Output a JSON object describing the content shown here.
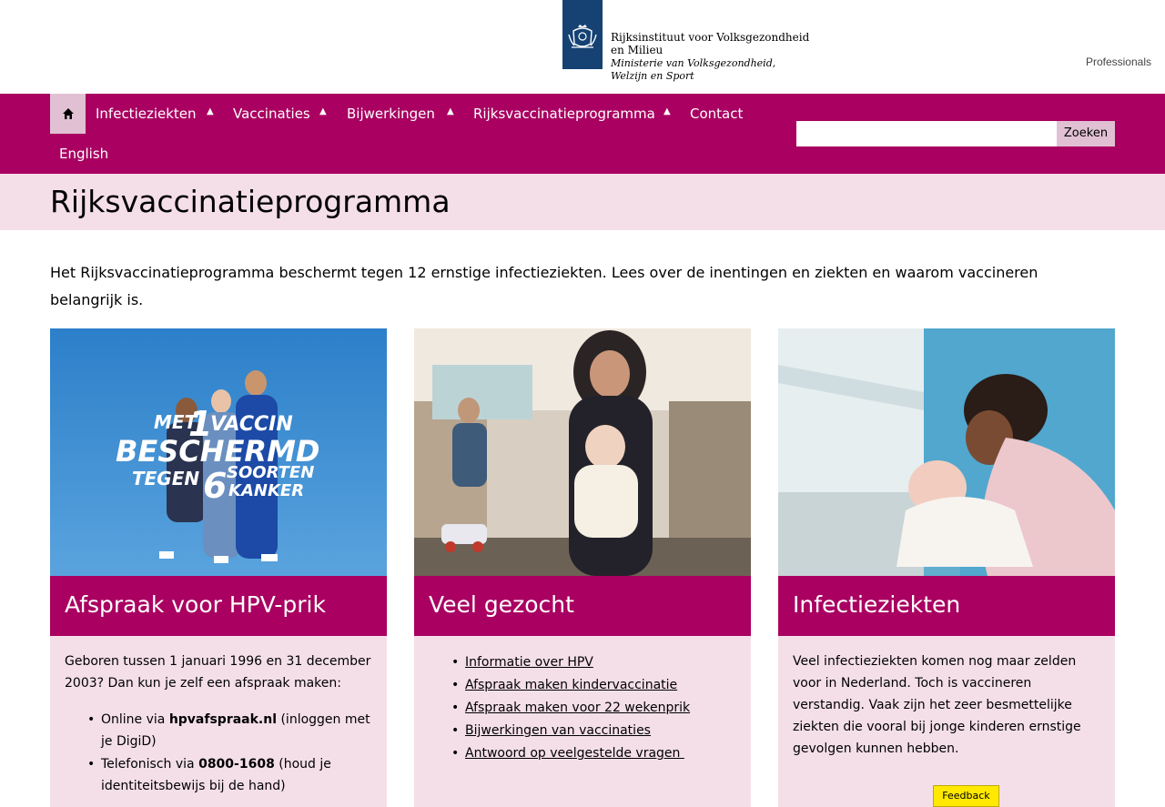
{
  "header": {
    "org_line1": "Rijksinstituut voor Volksgezondheid",
    "org_line2": "en Milieu",
    "ministry_line1": "Ministerie van Volksgezondheid,",
    "ministry_line2": "Welzijn en Sport",
    "professionals_link": "Professionals"
  },
  "nav": {
    "home_icon": "home-icon",
    "items": [
      {
        "label": "Infectieziekten",
        "has_dropdown": true
      },
      {
        "label": "Vaccinaties",
        "has_dropdown": true
      },
      {
        "label": "Bijwerkingen",
        "has_dropdown": true
      },
      {
        "label": "Rijksvaccinatieprogramma",
        "has_dropdown": true
      },
      {
        "label": "Contact",
        "has_dropdown": false
      },
      {
        "label": "English",
        "has_dropdown": false
      }
    ],
    "caret_glyph": "▲",
    "search": {
      "value": "",
      "button_label": "Zoeken"
    }
  },
  "page": {
    "title": "Rijksvaccinatieprogramma",
    "intro": "Het Rijksvaccinatieprogramma beschermt tegen 12 ernstige infectieziekten. Lees over de inentingen en ziekten en waarom vaccineren belangrijk is."
  },
  "cards": [
    {
      "title": "Afspraak voor HPV-prik",
      "image_text": {
        "line1_a": "MET",
        "line1_b": "1",
        "line1_c": "VACCIN",
        "line2": "BESCHERMD",
        "line3_a": "TEGEN",
        "line3_b": "6",
        "line3_c": "SOORTEN",
        "line4": "KANKER"
      },
      "body_text": "Geboren tussen 1 januari 1996 en 31 december 2003? Dan kun je zelf een afspraak maken:",
      "bullets": [
        {
          "pre": "Online via ",
          "bold": "hpvafspraak.nl",
          "post": " (inloggen met je DigiD)"
        },
        {
          "pre": "Telefonisch via ",
          "bold": "0800-1608",
          "post": " (houd je identiteitsbewijs bij de hand)"
        }
      ]
    },
    {
      "title": "Veel gezocht",
      "links": [
        "Informatie over HPV",
        "Afspraak maken kindervaccinatie",
        "Afspraak maken voor 22 wekenprik",
        "Bijwerkingen van vaccinaties",
        "Antwoord op veelgestelde vragen "
      ]
    },
    {
      "title": "Infectieziekten",
      "body_text": "Veel infectieziekten komen nog maar zelden voor in Nederland. Toch is vaccineren verstandig. Vaak zijn het zeer besmettelijke ziekten die vooral bij jonge kinderen ernstige gevolgen kunnen hebben."
    }
  ],
  "feedback_label": "Feedback",
  "colors": {
    "brand": "#a90061",
    "brand_light": "#f4dfe8",
    "logo_blue": "#154273",
    "feedback": "#ffe900"
  }
}
